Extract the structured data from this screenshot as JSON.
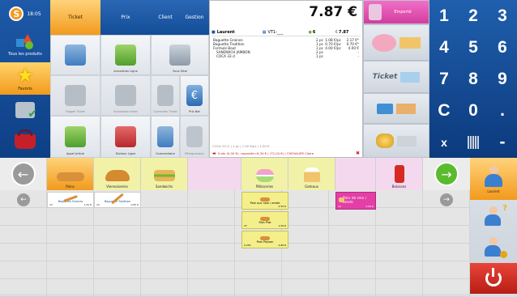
{
  "clock": "18:05",
  "sidebar": {
    "items": [
      {
        "label": "Tous les produits"
      },
      {
        "label": "Favoris"
      },
      {
        "label": ""
      },
      {
        "label": ""
      }
    ]
  },
  "tabs": [
    {
      "label": "Ticket"
    },
    {
      "label": "Prix"
    },
    {
      "label": "Client"
    },
    {
      "label": "Gestion"
    }
  ],
  "tiles": [
    {
      "label": ""
    },
    {
      "label": "Annulation Ligne"
    },
    {
      "label": "Sous Total"
    },
    {
      "label": "Rappel Ticket"
    },
    {
      "label": "Annulation ticket"
    },
    {
      "label": "Correction Ticket"
    },
    {
      "label": "Prix Net"
    },
    {
      "label": "Appel Article"
    },
    {
      "label": "Division Ligne"
    },
    {
      "label": "Commentaire"
    },
    {
      "label": "Réimpression"
    }
  ],
  "receipt": {
    "total": "7.87 €",
    "header": {
      "user": "Laurent",
      "table": "VT1-___",
      "count": "6",
      "amount": "7.87"
    },
    "lines": [
      {
        "name": "Baguette Graines",
        "qty": "2 pc",
        "unit": "1.08 €/pc",
        "total": "2.17 €*"
      },
      {
        "name": "Baguette Tradition",
        "qty": "1 pc",
        "unit": "0.70 €/pc",
        "total": "0.70 €*"
      },
      {
        "name": "Formule Bout",
        "qty": "1 pc",
        "unit": "4.00 €/pc",
        "total": "4.00 €"
      },
      {
        "name": "SANDWICH JAMBON",
        "qty": "2 pc",
        "unit": "",
        "total": "-"
      },
      {
        "name": "COCA 33 cl",
        "qty": "1 pc",
        "unit": "",
        "total": "-"
      }
    ],
    "footer1": "COCA 33 cl | 1 pc | 1.00 €/pc | 1.00 €",
    "footer2": "0 pts (0,00 €), cagnotte=6,34 € | (72,04 €) | CHEVALIER Claire"
  },
  "payment": {
    "header": "Emporté",
    "ticket_label": "Ticket"
  },
  "keypad": [
    "1",
    "2",
    "3",
    "4",
    "5",
    "6",
    "7",
    "8",
    "9",
    "C",
    "0",
    ".",
    "x",
    "",
    "-"
  ],
  "categories": [
    {
      "label": ""
    },
    {
      "label": "Pains"
    },
    {
      "label": "Viennoiseries"
    },
    {
      "label": "Sandwichs"
    },
    {
      "label": ""
    },
    {
      "label": "Pâtisseries"
    },
    {
      "label": "Gateaux"
    },
    {
      "label": ""
    },
    {
      "label": "Boissons"
    },
    {
      "label": ""
    }
  ],
  "products": [
    {
      "name": "Baguette Graines",
      "code": "23",
      "price": "1.20 €"
    },
    {
      "name": "Baguette Tradition",
      "code": "24",
      "price": "0.85 €"
    },
    {
      "name": "Pain aux noix / amde",
      "code": "",
      "price": "2.50 €"
    },
    {
      "name": "Pain Plat",
      "code": "27",
      "price": "1.50 €"
    },
    {
      "name": "Pain Paysan",
      "code": "0.250",
      "price": "4.80 €"
    },
    {
      "name": "Pain de mie / amde",
      "code": "44",
      "price": "2.80 €"
    }
  ],
  "users": {
    "name": "Laurent"
  },
  "colors": {
    "blue": "#1b56a3",
    "orange": "#f29a1c",
    "selected": "#f4c868",
    "green": "#5abb2f",
    "power": "#d62b1f",
    "highlight": "#f1f2a8",
    "pink": "#f4d9ee"
  }
}
